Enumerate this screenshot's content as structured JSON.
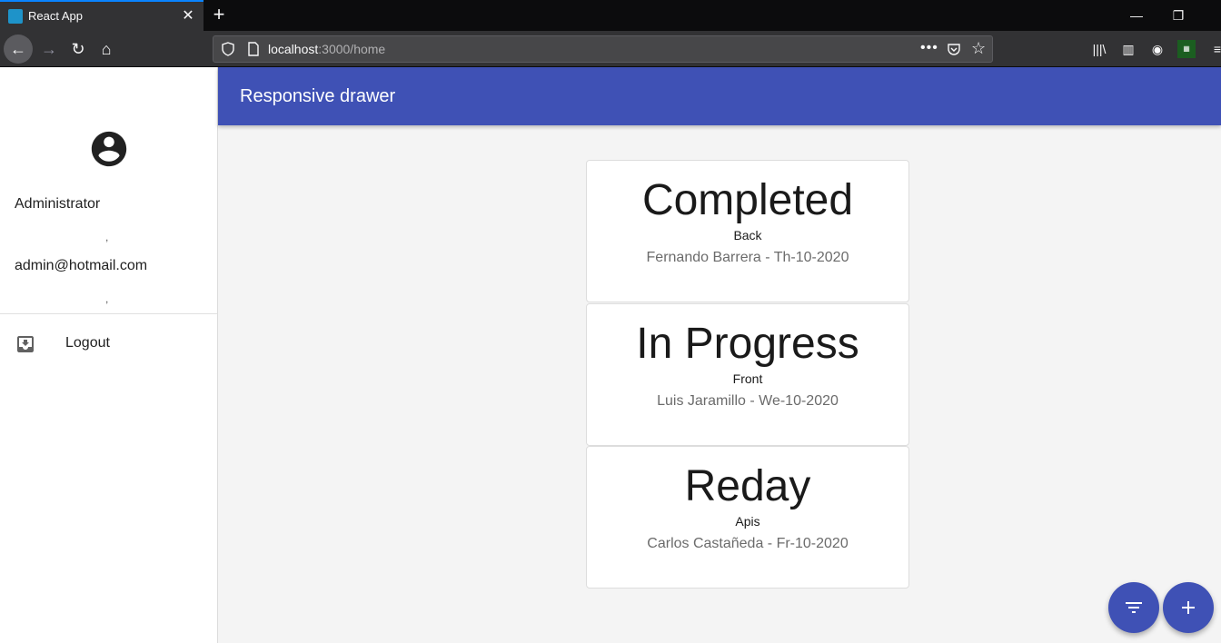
{
  "browser": {
    "tab_title": "React App",
    "url_host": "localhost",
    "url_path": ":3000/home"
  },
  "appbar": {
    "title": "Responsive drawer"
  },
  "drawer": {
    "user_name": "Administrator",
    "separator": ",",
    "user_email": "admin@hotmail.com",
    "logout_label": "Logout"
  },
  "tasks": [
    {
      "status": "Completed",
      "area": "Back",
      "meta": "Fernando Barrera - Th-10-2020"
    },
    {
      "status": "In Progress",
      "area": "Front",
      "meta": "Luis Jaramillo - We-10-2020"
    },
    {
      "status": "Reday",
      "area": "Apis",
      "meta": "Carlos Castañeda - Fr-10-2020"
    }
  ],
  "colors": {
    "primary": "#3f51b5",
    "appbar_text": "#ffffff"
  },
  "icons": {
    "filter_fab": "filter-icon",
    "add_fab": "add-icon",
    "avatar": "account-circle-icon",
    "logout": "inbox-download-icon"
  }
}
